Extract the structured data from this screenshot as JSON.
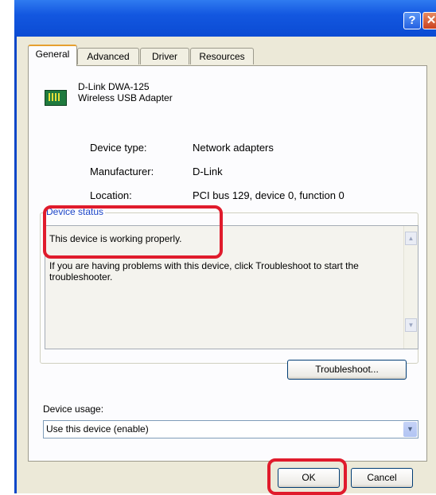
{
  "window": {
    "help_glyph": "?",
    "close_glyph": "✕"
  },
  "tabs": [
    {
      "label": "General",
      "active": true
    },
    {
      "label": "Advanced",
      "active": false
    },
    {
      "label": "Driver",
      "active": false
    },
    {
      "label": "Resources",
      "active": false
    }
  ],
  "device": {
    "name_line1": "D-Link DWA-125",
    "name_line2": "Wireless USB Adapter",
    "icon": "network-card-icon"
  },
  "properties": [
    {
      "label": "Device type:",
      "value": "Network adapters"
    },
    {
      "label": "Manufacturer:",
      "value": "D-Link"
    },
    {
      "label": "Location:",
      "value": "PCI bus 129, device 0, function 0"
    }
  ],
  "status": {
    "group_title": "Device status",
    "line1": "This device is working properly.",
    "line2": "If you are having problems with this device, click Troubleshoot to start the troubleshooter."
  },
  "buttons": {
    "troubleshoot": "Troubleshoot...",
    "ok": "OK",
    "cancel": "Cancel"
  },
  "usage": {
    "label": "Device usage:",
    "selected": "Use this device (enable)"
  },
  "colors": {
    "highlight": "#e01b2c",
    "titlebar": "#0b4bd3"
  }
}
